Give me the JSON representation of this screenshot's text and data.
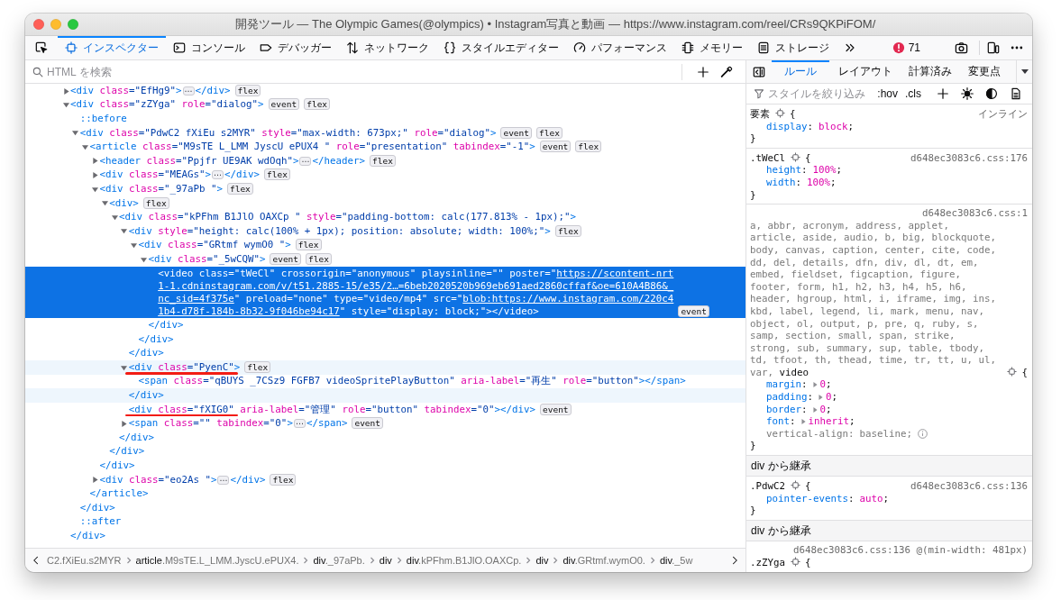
{
  "window": {
    "title": "開発ツール — The Olympic Games(@olympics) • Instagram写真と動画 — https://www.instagram.com/reel/CRs9QKPiFOM/"
  },
  "toolbar": {
    "tabs": [
      {
        "label": "インスペクター",
        "selected": true
      },
      {
        "label": "コンソール",
        "selected": false
      },
      {
        "label": "デバッガー",
        "selected": false
      },
      {
        "label": "ネットワーク",
        "selected": false
      },
      {
        "label": "スタイルエディター",
        "selected": false
      },
      {
        "label": "パフォーマンス",
        "selected": false
      },
      {
        "label": "メモリー",
        "selected": false
      },
      {
        "label": "ストレージ",
        "selected": false
      }
    ],
    "error_count": "71"
  },
  "inspector": {
    "search": {
      "placeholder": "HTML を検索"
    },
    "nodes": [
      {
        "kind": "element",
        "open": [
          {
            "kind": "tag",
            "text": "<div"
          },
          {
            "kind": "attr",
            "text": " class"
          },
          {
            "kind": "value",
            "text": "=\"EfHg9\""
          },
          {
            "kind": "tag",
            "text": ">"
          }
        ],
        "expanded": false,
        "ellipsis": "⋯",
        "close": [
          {
            "kind": "tag",
            "text": "</div>"
          }
        ],
        "badges": [
          "flex"
        ],
        "selected": false,
        "hovered": false,
        "marked": false
      },
      {
        "kind": "element",
        "open": [
          {
            "kind": "tag",
            "text": "<div"
          },
          {
            "kind": "attr",
            "text": " class"
          },
          {
            "kind": "value",
            "text": "=\"zZYga\""
          },
          {
            "kind": "attr",
            "text": " role"
          },
          {
            "kind": "value",
            "text": "=\"dialog\""
          },
          {
            "kind": "tag",
            "text": ">"
          }
        ],
        "expanded": true,
        "badges": [
          "event",
          "flex"
        ],
        "selected": false,
        "hovered": false,
        "marked": false,
        "close": [
          {
            "kind": "tag",
            "text": "</div>"
          }
        ],
        "children": [
          {
            "kind": "pseudo",
            "text": "::before",
            "selected": false,
            "hovered": false,
            "marked": false
          },
          {
            "kind": "element",
            "open": [
              {
                "kind": "tag",
                "text": "<div"
              },
              {
                "kind": "attr",
                "text": " class"
              },
              {
                "kind": "value",
                "text": "=\"PdwC2 fXiEu s2MYR\""
              },
              {
                "kind": "attr",
                "text": " style"
              },
              {
                "kind": "value",
                "text": "=\"max-width: 673px;\""
              },
              {
                "kind": "attr",
                "text": " role"
              },
              {
                "kind": "value",
                "text": "=\"dialog\""
              },
              {
                "kind": "tag",
                "text": ">"
              }
            ],
            "expanded": true,
            "badges": [
              "event",
              "flex"
            ],
            "selected": false,
            "hovered": false,
            "marked": false,
            "close": [
              {
                "kind": "tag",
                "text": "</div>"
              }
            ],
            "children": [
              {
                "kind": "element",
                "open": [
                  {
                    "kind": "tag",
                    "text": "<article"
                  },
                  {
                    "kind": "attr",
                    "text": " class"
                  },
                  {
                    "kind": "value",
                    "text": "=\"M9sTE L_LMM JyscU ePUX4 \""
                  },
                  {
                    "kind": "attr",
                    "text": " role"
                  },
                  {
                    "kind": "value",
                    "text": "=\"presentation\""
                  },
                  {
                    "kind": "attr",
                    "text": " tabindex"
                  },
                  {
                    "kind": "value",
                    "text": "=\"-1\""
                  },
                  {
                    "kind": "tag",
                    "text": ">"
                  }
                ],
                "expanded": true,
                "badges": [
                  "event",
                  "flex"
                ],
                "selected": false,
                "hovered": false,
                "marked": false,
                "close": [
                  {
                    "kind": "tag",
                    "text": "</article>"
                  }
                ],
                "children": [
                  {
                    "kind": "element",
                    "open": [
                      {
                        "kind": "tag",
                        "text": "<header"
                      },
                      {
                        "kind": "attr",
                        "text": " class"
                      },
                      {
                        "kind": "value",
                        "text": "=\"Ppjfr UE9AK wdOqh\""
                      },
                      {
                        "kind": "tag",
                        "text": ">"
                      }
                    ],
                    "expanded": false,
                    "ellipsis": "⋯",
                    "close": [
                      {
                        "kind": "tag",
                        "text": "</header>"
                      }
                    ],
                    "badges": [
                      "flex"
                    ],
                    "selected": false,
                    "hovered": false,
                    "marked": false
                  },
                  {
                    "kind": "element",
                    "open": [
                      {
                        "kind": "tag",
                        "text": "<div"
                      },
                      {
                        "kind": "attr",
                        "text": " class"
                      },
                      {
                        "kind": "value",
                        "text": "=\"MEAGs\""
                      },
                      {
                        "kind": "tag",
                        "text": ">"
                      }
                    ],
                    "expanded": false,
                    "ellipsis": "⋯",
                    "close": [
                      {
                        "kind": "tag",
                        "text": "</div>"
                      }
                    ],
                    "badges": [
                      "flex"
                    ],
                    "selected": false,
                    "hovered": false,
                    "marked": false
                  },
                  {
                    "kind": "element",
                    "open": [
                      {
                        "kind": "tag",
                        "text": "<div"
                      },
                      {
                        "kind": "attr",
                        "text": " class"
                      },
                      {
                        "kind": "value",
                        "text": "=\"_97aPb \""
                      },
                      {
                        "kind": "tag",
                        "text": ">"
                      }
                    ],
                    "expanded": true,
                    "badges": [
                      "flex"
                    ],
                    "selected": false,
                    "hovered": false,
                    "marked": false,
                    "close": [
                      {
                        "kind": "tag",
                        "text": "</div>"
                      }
                    ],
                    "children": [
                      {
                        "kind": "element",
                        "open": [
                          {
                            "kind": "tag",
                            "text": "<div"
                          },
                          {
                            "kind": "tag",
                            "text": ">"
                          }
                        ],
                        "expanded": true,
                        "badges": [
                          "flex"
                        ],
                        "selected": false,
                        "hovered": false,
                        "marked": false,
                        "close": [
                          {
                            "kind": "tag",
                            "text": "</div>"
                          }
                        ],
                        "children": [
                          {
                            "kind": "element",
                            "open": [
                              {
                                "kind": "tag",
                                "text": "<div"
                              },
                              {
                                "kind": "attr",
                                "text": " class"
                              },
                              {
                                "kind": "value",
                                "text": "=\"kPFhm B1JlO OAXCp \""
                              },
                              {
                                "kind": "attr",
                                "text": " style"
                              },
                              {
                                "kind": "value",
                                "text": "=\"padding-bottom: calc(177.813% - 1px);\""
                              },
                              {
                                "kind": "tag",
                                "text": ">"
                              }
                            ],
                            "expanded": true,
                            "selected": false,
                            "hovered": false,
                            "marked": false,
                            "close": [
                              {
                                "kind": "tag",
                                "text": "</div>"
                              }
                            ],
                            "children": [
                              {
                                "kind": "element",
                                "open": [
                                  {
                                    "kind": "tag",
                                    "text": "<div"
                                  },
                                  {
                                    "kind": "attr",
                                    "text": " style"
                                  },
                                  {
                                    "kind": "value",
                                    "text": "=\"height: calc(100% + 1px); position: absolute; width: 100%;\""
                                  },
                                  {
                                    "kind": "tag",
                                    "text": ">"
                                  }
                                ],
                                "expanded": true,
                                "badges": [
                                  "flex"
                                ],
                                "selected": false,
                                "hovered": false,
                                "marked": false,
                                "close": [
                                  {
                                    "kind": "tag",
                                    "text": "</div>"
                                  }
                                ],
                                "children": [
                                  {
                                    "kind": "element",
                                    "open": [
                                      {
                                        "kind": "tag",
                                        "text": "<div"
                                      },
                                      {
                                        "kind": "attr",
                                        "text": " class"
                                      },
                                      {
                                        "kind": "value",
                                        "text": "=\"GRtmf wymO0 \""
                                      },
                                      {
                                        "kind": "tag",
                                        "text": ">"
                                      }
                                    ],
                                    "expanded": true,
                                    "badges": [
                                      "flex"
                                    ],
                                    "selected": false,
                                    "hovered": false,
                                    "marked": false,
                                    "close": [
                                      {
                                        "kind": "tag",
                                        "text": "</div>"
                                      }
                                    ],
                                    "children": [
                                      {
                                        "kind": "element",
                                        "open": [
                                          {
                                            "kind": "tag",
                                            "text": "<div"
                                          },
                                          {
                                            "kind": "attr",
                                            "text": " class"
                                          },
                                          {
                                            "kind": "value",
                                            "text": "=\"_5wCQW\""
                                          },
                                          {
                                            "kind": "tag",
                                            "text": ">"
                                          }
                                        ],
                                        "expanded": true,
                                        "badges": [
                                          "event",
                                          "flex"
                                        ],
                                        "selected": false,
                                        "hovered": false,
                                        "marked": false,
                                        "close": [
                                          {
                                            "kind": "tag",
                                            "text": "</div>"
                                          }
                                        ],
                                        "children": [
                                          {
                                            "kind": "element",
                                            "open": [
                                              {
                                                "kind": "tag",
                                                "text": "<video"
                                              },
                                              {
                                                "kind": "attr",
                                                "text": " class"
                                              },
                                              {
                                                "kind": "value",
                                                "text": "=\"tWeCl\""
                                              },
                                              {
                                                "kind": "attr",
                                                "text": " crossorigin"
                                              },
                                              {
                                                "kind": "value",
                                                "text": "=\"anonymous\""
                                              },
                                              {
                                                "kind": "attr",
                                                "text": " playsinline"
                                              },
                                              {
                                                "kind": "value",
                                                "text": "=\"\""
                                              },
                                              {
                                                "kind": "attr",
                                                "text": " poster"
                                              },
                                              {
                                                "kind": "value",
                                                "text": "=\""
                                              },
                                              {
                                                "kind": "link",
                                                "text": "https://scontent-nrt1-1.cdninstagram.com/v/t51.2885-15/e35/2…=6beb2020520b969eb691aed2860cffaf&oe=610A4B86&_nc_sid=4f375e"
                                              },
                                              {
                                                "kind": "value",
                                                "text": "\""
                                              },
                                              {
                                                "kind": "attr",
                                                "text": " preload"
                                              },
                                              {
                                                "kind": "value",
                                                "text": "=\"none\""
                                              },
                                              {
                                                "kind": "attr",
                                                "text": " type"
                                              },
                                              {
                                                "kind": "value",
                                                "text": "=\"video/mp4\""
                                              },
                                              {
                                                "kind": "attr",
                                                "text": " src"
                                              },
                                              {
                                                "kind": "value",
                                                "text": "=\""
                                              },
                                              {
                                                "kind": "link",
                                                "text": "blob:https://www.instagram.com/220c41b4-d78f-184b-8b32-9f046be94c17"
                                              },
                                              {
                                                "kind": "value",
                                                "text": "\""
                                              },
                                              {
                                                "kind": "attr",
                                                "text": " style"
                                              },
                                              {
                                                "kind": "value",
                                                "text": "=\"display: block;\""
                                              },
                                              {
                                                "kind": "tag",
                                                "text": ">"
                                              }
                                            ],
                                            "close": [
                                              {
                                                "kind": "tag",
                                                "text": "</video>"
                                              }
                                            ],
                                            "badges": [
                                              "event"
                                            ],
                                            "selected": true,
                                            "hovered": false,
                                            "marked": false
                                          }
                                        ]
                                      }
                                    ]
                                  }
                                ]
                              },
                              {
                                "kind": "element",
                                "open": [
                                  {
                                    "kind": "tag",
                                    "text": "<div"
                                  },
                                  {
                                    "kind": "attr",
                                    "text": " class"
                                  },
                                  {
                                    "kind": "value",
                                    "text": "=\"PyenC\""
                                  },
                                  {
                                    "kind": "tag",
                                    "text": ">"
                                  }
                                ],
                                "expanded": true,
                                "badges": [
                                  "flex"
                                ],
                                "selected": false,
                                "hovered": true,
                                "marked": true,
                                "close": [
                                  {
                                    "kind": "tag",
                                    "text": "</div>"
                                  }
                                ],
                                "children": [
                                  {
                                    "kind": "element",
                                    "open": [
                                      {
                                        "kind": "tag",
                                        "text": "<span"
                                      },
                                      {
                                        "kind": "attr",
                                        "text": " class"
                                      },
                                      {
                                        "kind": "value",
                                        "text": "=\"qBUYS _7CSz9 FGFB7 videoSpritePlayButton\""
                                      },
                                      {
                                        "kind": "attr",
                                        "text": " aria-label"
                                      },
                                      {
                                        "kind": "value",
                                        "text": "=\"再生\""
                                      },
                                      {
                                        "kind": "attr",
                                        "text": " role"
                                      },
                                      {
                                        "kind": "value",
                                        "text": "=\"button\""
                                      },
                                      {
                                        "kind": "tag",
                                        "text": ">"
                                      }
                                    ],
                                    "close": [
                                      {
                                        "kind": "tag",
                                        "text": "</span>"
                                      }
                                    ],
                                    "selected": false,
                                    "hovered": false,
                                    "marked": false
                                  }
                                ]
                              },
                              {
                                "kind": "element",
                                "open": [
                                  {
                                    "kind": "tag",
                                    "text": "<div"
                                  },
                                  {
                                    "kind": "attr",
                                    "text": " class"
                                  },
                                  {
                                    "kind": "value",
                                    "text": "=\"fXIG0\""
                                  },
                                  {
                                    "kind": "attr",
                                    "text": " aria-label"
                                  },
                                  {
                                    "kind": "value",
                                    "text": "=\"管理\""
                                  },
                                  {
                                    "kind": "attr",
                                    "text": " role"
                                  },
                                  {
                                    "kind": "value",
                                    "text": "=\"button\""
                                  },
                                  {
                                    "kind": "attr",
                                    "text": " tabindex"
                                  },
                                  {
                                    "kind": "value",
                                    "text": "=\"0\""
                                  },
                                  {
                                    "kind": "tag",
                                    "text": ">"
                                  }
                                ],
                                "close": [
                                  {
                                    "kind": "tag",
                                    "text": "</div>"
                                  }
                                ],
                                "badges": [
                                  "event"
                                ],
                                "selected": false,
                                "hovered": false,
                                "marked": true
                              },
                              {
                                "kind": "element",
                                "open": [
                                  {
                                    "kind": "tag",
                                    "text": "<span"
                                  },
                                  {
                                    "kind": "attr",
                                    "text": " class"
                                  },
                                  {
                                    "kind": "value",
                                    "text": "=\"\""
                                  },
                                  {
                                    "kind": "attr",
                                    "text": " tabindex"
                                  },
                                  {
                                    "kind": "value",
                                    "text": "=\"0\""
                                  },
                                  {
                                    "kind": "tag",
                                    "text": ">"
                                  }
                                ],
                                "expanded": false,
                                "ellipsis": "⋯",
                                "close": [
                                  {
                                    "kind": "tag",
                                    "text": "</span>"
                                  }
                                ],
                                "badges": [
                                  "event"
                                ],
                                "selected": false,
                                "hovered": false,
                                "marked": false
                              }
                            ]
                          }
                        ]
                      }
                    ]
                  },
                  {
                    "kind": "element",
                    "open": [
                      {
                        "kind": "tag",
                        "text": "<div"
                      },
                      {
                        "kind": "attr",
                        "text": " class"
                      },
                      {
                        "kind": "value",
                        "text": "=\"eo2As \""
                      },
                      {
                        "kind": "tag",
                        "text": ">"
                      }
                    ],
                    "expanded": false,
                    "ellipsis": "⋯",
                    "close": [
                      {
                        "kind": "tag",
                        "text": "</div>"
                      }
                    ],
                    "badges": [
                      "flex"
                    ],
                    "selected": false,
                    "hovered": false,
                    "marked": false
                  }
                ]
              }
            ]
          },
          {
            "kind": "pseudo",
            "text": "::after",
            "selected": false,
            "hovered": false,
            "marked": false
          }
        ]
      }
    ],
    "breadcrumbs": [
      {
        "classes": "C2.fXiEu.s2MYR"
      },
      {
        "tag": "article",
        "classes": ".M9sTE.L_LMM.JyscU.ePUX4."
      },
      {
        "tag": "div",
        "classes": "._97aPb."
      },
      {
        "tag": "div"
      },
      {
        "tag": "div",
        "classes": ".kPFhm.B1JlO.OAXCp."
      },
      {
        "tag": "div"
      },
      {
        "tag": "div",
        "classes": ".GRtmf.wymO0."
      },
      {
        "tag": "div",
        "classes": "._5w"
      }
    ]
  },
  "sidebar": {
    "tabs": [
      {
        "label": "ルール",
        "selected": true
      },
      {
        "label": "レイアウト",
        "selected": false
      },
      {
        "label": "計算済み",
        "selected": false
      },
      {
        "label": "変更点",
        "selected": false
      }
    ],
    "filter": {
      "placeholder": "スタイルを絞り込み"
    },
    "toggles": [
      ":hov",
      ".cls"
    ],
    "rules": [
      {
        "kind": "rule",
        "selector": [
          {
            "text": "要素",
            "matched": true
          }
        ],
        "open_brace": "{",
        "source": "インライン",
        "declarations": [
          {
            "property": "display",
            "colon": ":",
            "value": "block",
            "semicolon": ";",
            "active": true
          }
        ],
        "close_brace": "}"
      },
      {
        "kind": "rule",
        "selector": [
          {
            "text": ".tWeCl",
            "matched": true
          }
        ],
        "open_brace": "{",
        "source": "d648ec3083c6.css:176",
        "declarations": [
          {
            "property": "height",
            "colon": ":",
            "value": "100%",
            "semicolon": ";",
            "active": true
          },
          {
            "property": "width",
            "colon": ":",
            "value": "100%",
            "semicolon": ";",
            "active": true
          }
        ],
        "close_brace": "}"
      },
      {
        "kind": "rule",
        "selector": [
          {
            "text": "a, abbr, acronym, address, applet, article, aside, audio, b, big, blockquote, body, canvas, caption, center, cite, code, dd, del, details, dfn, div, dl, dt, em, embed, fieldset, figcaption, figure, footer, form, h1, h2, h3, h4, h5, h6, header, hgroup, html, i, iframe, img, ins, kbd, label, legend, li, mark, menu, nav, object, ol, output, p, pre, q, ruby, s, samp, section, small, span, strike, strong, sub, summary, sup, table, tbody, td, tfoot, th, thead, time, tr, tt, u, ul, var,",
            "matched": false
          },
          {
            "text": "video",
            "matched": true
          }
        ],
        "open_brace": "{",
        "source": "d648ec3083c6.css:1",
        "declarations": [
          {
            "property": "margin",
            "colon": ":",
            "expanded": false,
            "value": "0",
            "semicolon": ";",
            "active": true
          },
          {
            "property": "padding",
            "colon": ":",
            "expanded": false,
            "value": "0",
            "semicolon": ";",
            "active": true
          },
          {
            "property": "border",
            "colon": ":",
            "expanded": false,
            "value": "0",
            "semicolon": ";",
            "active": true
          },
          {
            "property": "font",
            "colon": ":",
            "expanded": false,
            "value": "inherit",
            "semicolon": ";",
            "active": true
          },
          {
            "property": "vertical-align",
            "colon": ":",
            "value": "baseline",
            "semicolon": ";",
            "active": false
          }
        ],
        "close_brace": "}"
      },
      {
        "kind": "inherited",
        "label": "div から継承"
      },
      {
        "kind": "rule",
        "selector": [
          {
            "text": ".PdwC2",
            "matched": true
          }
        ],
        "open_brace": "{",
        "source": "d648ec3083c6.css:136",
        "declarations": [
          {
            "property": "pointer-events",
            "colon": ":",
            "value": "auto",
            "semicolon": ";",
            "active": true
          }
        ],
        "close_brace": "}"
      },
      {
        "kind": "inherited",
        "label": "div から継承"
      },
      {
        "kind": "rule",
        "selector": [
          {
            "text": ".zZYga",
            "matched": true
          }
        ],
        "open_brace": "{",
        "source": "d648ec3083c6.css:136 @(min-width: 481px)"
      }
    ]
  }
}
